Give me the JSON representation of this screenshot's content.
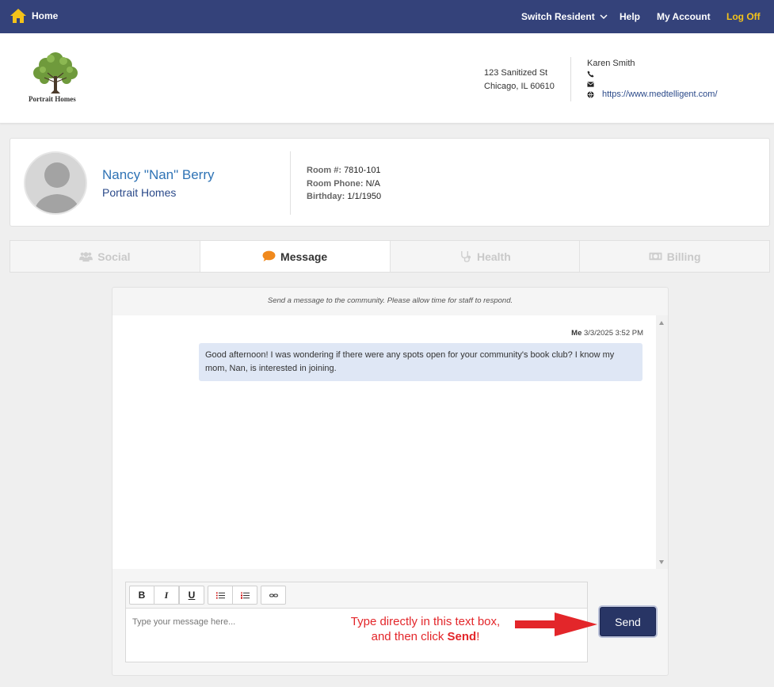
{
  "nav": {
    "home_label": "Home",
    "switch_label": "Switch Resident",
    "help_label": "Help",
    "account_label": "My Account",
    "logoff_label": "Log Off",
    "logoff_color": "#f3c21a",
    "bg_color": "#34427a"
  },
  "header": {
    "logo_text": "Portrait Homes",
    "address_line1": "123 Sanitized St",
    "address_line2": "Chicago, IL 60610",
    "contact_name": "Karen Smith",
    "website": "https://www.medtelligent.com/"
  },
  "resident": {
    "name": "Nancy \"Nan\" Berry",
    "community": "Portrait Homes",
    "room_label": "Room #:",
    "room_value": "7810-101",
    "phone_label": "Room Phone:",
    "phone_value": "N/A",
    "birthday_label": "Birthday:",
    "birthday_value": "1/1/1950"
  },
  "tabs": [
    {
      "label": "Social",
      "icon": "users-icon",
      "active": false
    },
    {
      "label": "Message",
      "icon": "chat-bubble-icon",
      "active": true
    },
    {
      "label": "Health",
      "icon": "stethoscope-icon",
      "active": false
    },
    {
      "label": "Billing",
      "icon": "money-bill-icon",
      "active": false
    }
  ],
  "messages": {
    "instruction": "Send a message to the community. Please allow time for staff to respond.",
    "items": [
      {
        "sender": "Me",
        "timestamp": "3/3/2025 3:52 PM",
        "text": "Good afternoon! I was wondering if there were any spots open for your community's book club? I know my mom, Nan, is interested in joining."
      }
    ]
  },
  "editor": {
    "bold": "B",
    "italic": "I",
    "underline": "U",
    "placeholder": "Type your message here..."
  },
  "annotation": {
    "line1": "Type directly in this text box,",
    "line2_pre": "and then click ",
    "line2_bold": "Send",
    "line2_post": "!",
    "color": "#e3262a"
  },
  "send_label": "Send"
}
